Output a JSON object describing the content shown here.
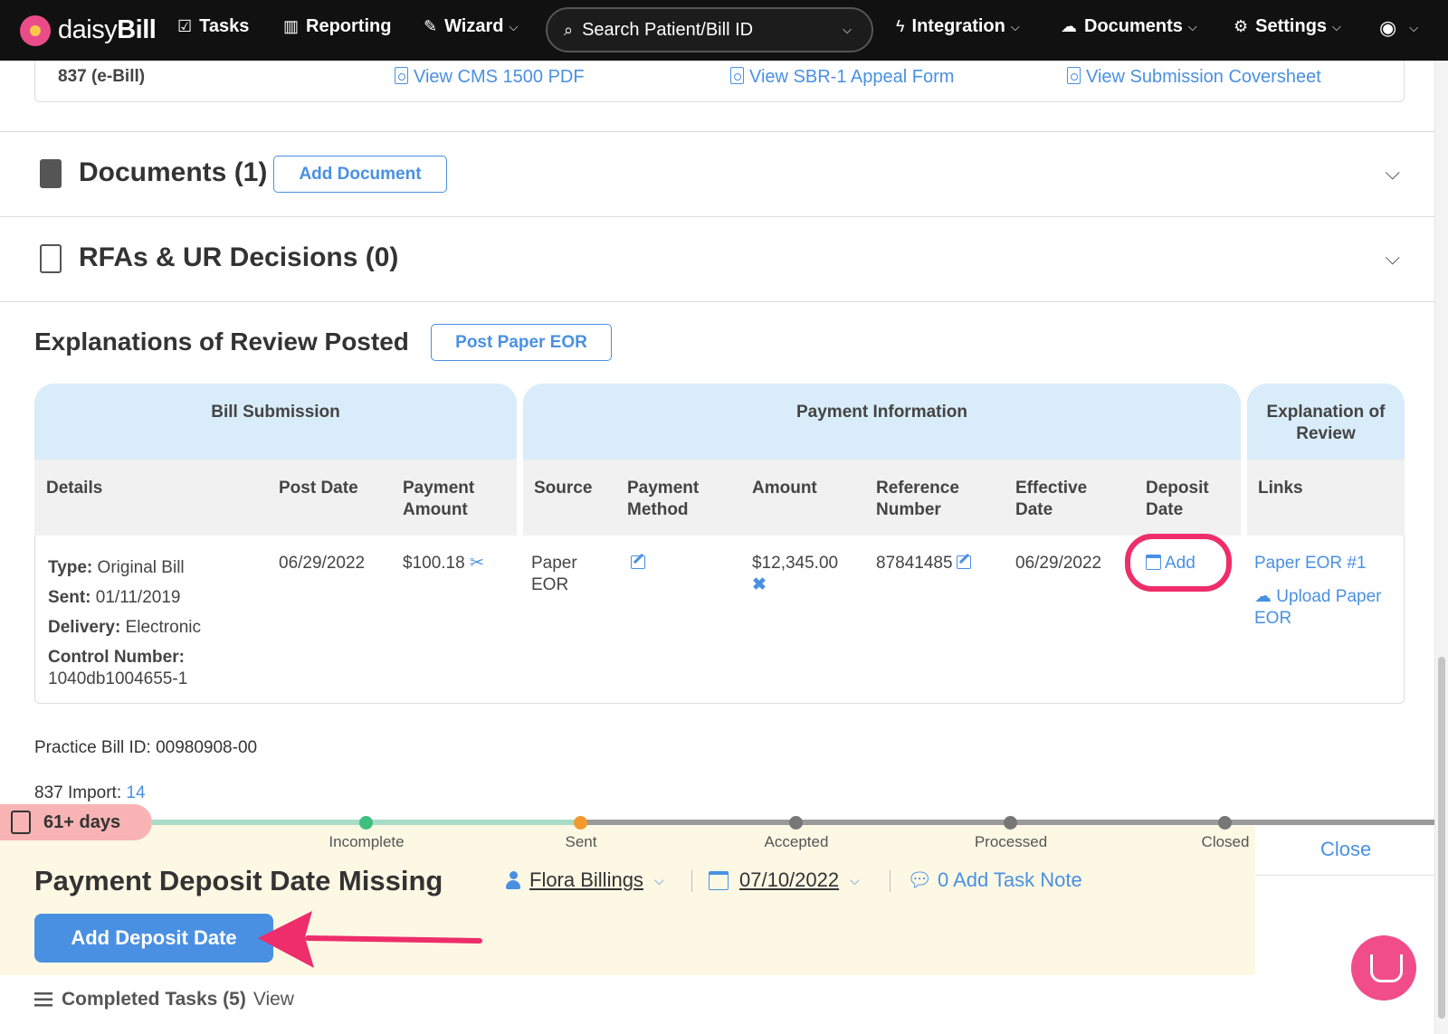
{
  "nav": {
    "brand_daisy": "daisy",
    "brand_bill": "Bill",
    "tasks": "Tasks",
    "reporting": "Reporting",
    "wizard": "Wizard",
    "search_placeholder": "Search Patient/Bill ID",
    "integration": "Integration",
    "documents": "Documents",
    "settings": "Settings"
  },
  "formats": {
    "label": "837 (e-Bill)",
    "link1": "View CMS 1500 PDF",
    "link2": "View SBR-1 Appeal Form",
    "link3": "View Submission Coversheet"
  },
  "documents_section": {
    "title": "Documents (1)",
    "button": "Add Document"
  },
  "rfas_section": {
    "title": "RFAs & UR Decisions (0)"
  },
  "eor": {
    "title": "Explanations of Review Posted",
    "post_button": "Post Paper EOR",
    "group_bill": "Bill Submission",
    "group_payment": "Payment Information",
    "group_eor": "Explanation of Review",
    "headers": {
      "details": "Details",
      "post_date": "Post Date",
      "payment_amount": "Payment Amount",
      "source": "Source",
      "payment_method": "Payment Method",
      "amount": "Amount",
      "reference_number": "Reference Number",
      "effective_date": "Effective Date",
      "deposit_date": "Deposit Date",
      "links": "Links"
    },
    "row": {
      "type_label": "Type:",
      "type_value": "Original Bill",
      "sent_label": "Sent:",
      "sent_value": "01/11/2019",
      "delivery_label": "Delivery:",
      "delivery_value": "Electronic",
      "control_label": "Control Number:",
      "control_value": "1040db1004655-1",
      "post_date": "06/29/2022",
      "payment_amount": "$100.18",
      "source": "Paper EOR",
      "amount": "$12,345.00",
      "reference_number": "87841485",
      "effective_date": "06/29/2022",
      "deposit_add": "Add",
      "link_eor": "Paper EOR #1",
      "link_upload": "Upload Paper EOR"
    }
  },
  "practice_bill_id": "Practice Bill ID: 00980908-00",
  "import_label": "837 Import:",
  "import_value": "14",
  "task": {
    "age": "61+ days",
    "steps": [
      "Incomplete",
      "Sent",
      "Accepted",
      "Processed",
      "Closed"
    ],
    "close": "Close",
    "title": "Payment Deposit Date Missing",
    "assignee": "Flora Billings",
    "due_date": "07/10/2022",
    "note": "0 Add Task Note",
    "button": "Add Deposit Date",
    "completed": "Completed Tasks (5)",
    "completed_view": "View"
  },
  "colors": {
    "accent": "#4a90e2",
    "highlight": "#ee2d6b",
    "header_bg": "#d9ecf9",
    "task_bg": "#fdf8e4",
    "age_badge": "#f8b4b4"
  }
}
